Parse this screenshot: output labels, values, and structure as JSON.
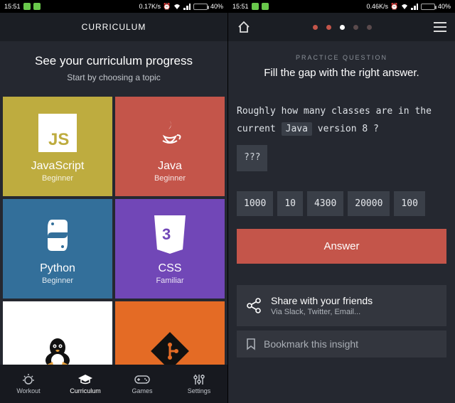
{
  "statusbar": {
    "time": "15:51",
    "net_left": "0.17K/s",
    "net_right": "0.46K/s",
    "battery": "40%"
  },
  "left": {
    "title": "CURRICULUM",
    "hero_heading": "See your curriculum progress",
    "hero_sub": "Start by choosing a topic",
    "tiles": [
      {
        "name": "JavaScript",
        "level": "Beginner",
        "icon": "js"
      },
      {
        "name": "Java",
        "level": "Beginner",
        "icon": "java"
      },
      {
        "name": "Python",
        "level": "Beginner",
        "icon": "python"
      },
      {
        "name": "CSS",
        "level": "Familiar",
        "icon": "css"
      },
      {
        "name": "",
        "level": "",
        "icon": "linux"
      },
      {
        "name": "",
        "level": "",
        "icon": "git"
      }
    ],
    "nav": [
      {
        "label": "Workout"
      },
      {
        "label": "Curriculum"
      },
      {
        "label": "Games"
      },
      {
        "label": "Settings"
      }
    ]
  },
  "right": {
    "practice_label": "PRACTICE QUESTION",
    "prompt": "Fill the gap with the right answer.",
    "question_pre": "Roughly how many classes are in the current ",
    "question_token": "Java",
    "question_post": " version 8 ?",
    "blank": "???",
    "choices": [
      "1000",
      "10",
      "4300",
      "20000",
      "100"
    ],
    "answer_label": "Answer",
    "share_title": "Share with your friends",
    "share_sub": "Via Slack, Twitter, Email...",
    "bookmark_label": "Bookmark this insight"
  }
}
